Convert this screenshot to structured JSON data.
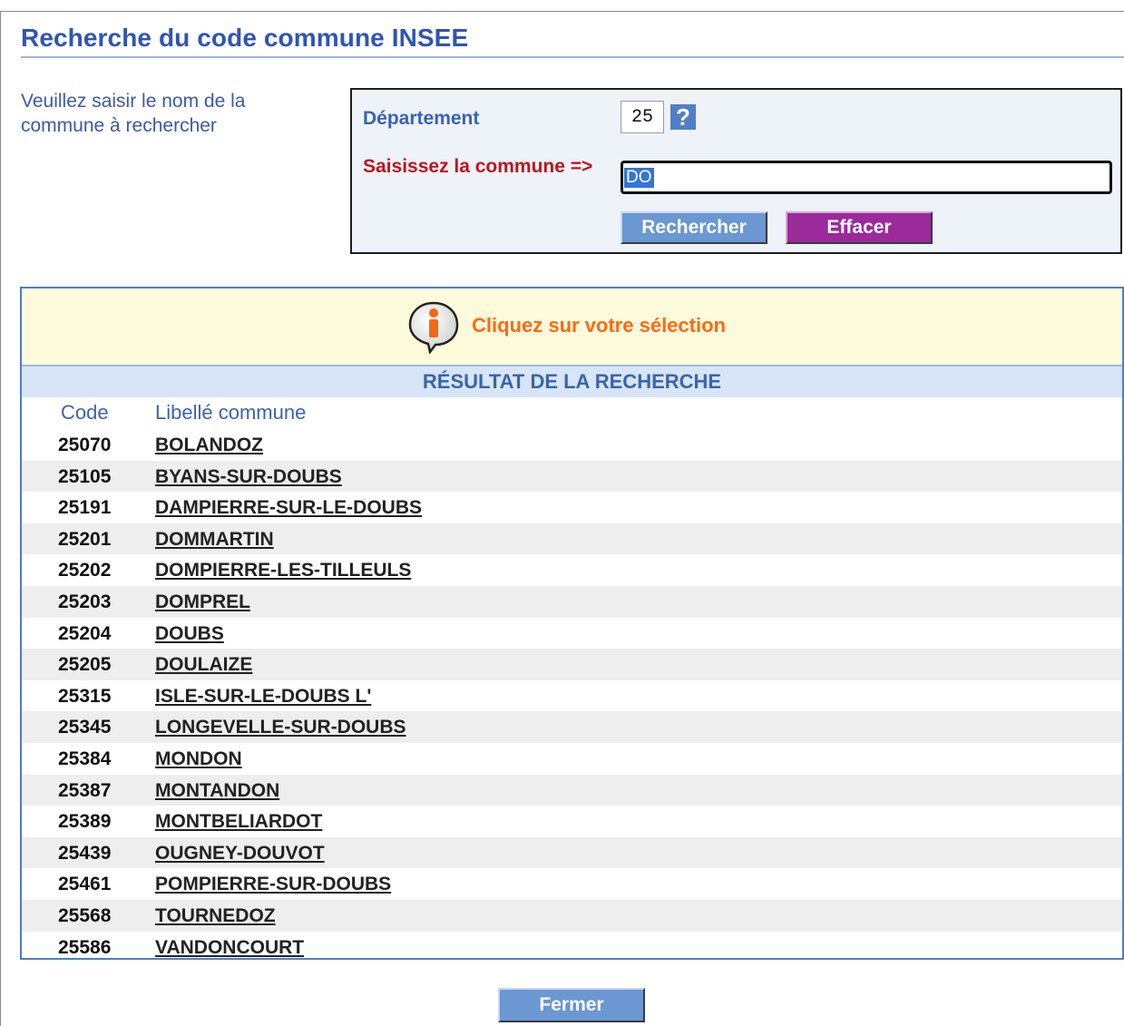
{
  "page": {
    "title": "Recherche du code commune INSEE",
    "instructions": "Veuillez saisir le nom de la commune à rechercher"
  },
  "search": {
    "department_label": "Département",
    "department_value": "25",
    "help_icon": "?",
    "commune_label": "Saisissez la commune =>",
    "commune_value": "DO",
    "search_button": "Rechercher",
    "clear_button": "Effacer"
  },
  "results": {
    "info_text": "Cliquez sur votre sélection",
    "header": "RÉSULTAT DE LA RECHERCHE",
    "columns": {
      "code": "Code",
      "name": "Libellé commune"
    },
    "rows": [
      {
        "code": "25070",
        "name": "BOLANDOZ"
      },
      {
        "code": "25105",
        "name": "BYANS-SUR-DOUBS"
      },
      {
        "code": "25191",
        "name": "DAMPIERRE-SUR-LE-DOUBS"
      },
      {
        "code": "25201",
        "name": "DOMMARTIN"
      },
      {
        "code": "25202",
        "name": "DOMPIERRE-LES-TILLEULS"
      },
      {
        "code": "25203",
        "name": "DOMPREL"
      },
      {
        "code": "25204",
        "name": "DOUBS"
      },
      {
        "code": "25205",
        "name": "DOULAIZE"
      },
      {
        "code": "25315",
        "name": "ISLE-SUR-LE-DOUBS L'"
      },
      {
        "code": "25345",
        "name": "LONGEVELLE-SUR-DOUBS"
      },
      {
        "code": "25384",
        "name": "MONDON"
      },
      {
        "code": "25387",
        "name": "MONTANDON"
      },
      {
        "code": "25389",
        "name": "MONTBELIARDOT"
      },
      {
        "code": "25439",
        "name": "OUGNEY-DOUVOT"
      },
      {
        "code": "25461",
        "name": "POMPIERRE-SUR-DOUBS"
      },
      {
        "code": "25568",
        "name": "TOURNEDOZ"
      },
      {
        "code": "25586",
        "name": "VANDONCOURT"
      }
    ]
  },
  "footer": {
    "close_button": "Fermer"
  },
  "colors": {
    "title": "#2f55b4",
    "label_blue": "#3a63b5",
    "label_red": "#c0141c",
    "info_orange": "#ff6a13",
    "search_button": "#6b97d2",
    "clear_button": "#9b2a9b",
    "info_bar": "#fefadc",
    "results_header": "#d7e5f6"
  }
}
